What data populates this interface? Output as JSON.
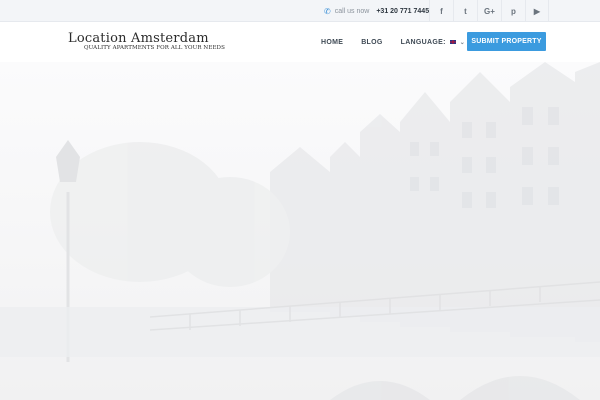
{
  "topbar": {
    "call_label": "call us now",
    "phone": "+31 20 771 7445",
    "social": [
      {
        "icon": "facebook-icon",
        "glyph": "f"
      },
      {
        "icon": "twitter-icon",
        "glyph": "t"
      },
      {
        "icon": "google-plus-icon",
        "glyph": "G+"
      },
      {
        "icon": "pinterest-icon",
        "glyph": "p"
      },
      {
        "icon": "youtube-icon",
        "glyph": "▶"
      }
    ]
  },
  "header": {
    "logo_title": "Location Amsterdam",
    "logo_tagline": "QUALITY APARTMENTS FOR ALL YOUR NEEDS",
    "nav": {
      "home": "HOME",
      "blog": "BLOG",
      "language": "LANGUAGE:"
    },
    "submit_label": "SUBMIT PROPERTY"
  },
  "colors": {
    "accent": "#3b9bdf",
    "topbar_bg": "#f3f5f8"
  }
}
